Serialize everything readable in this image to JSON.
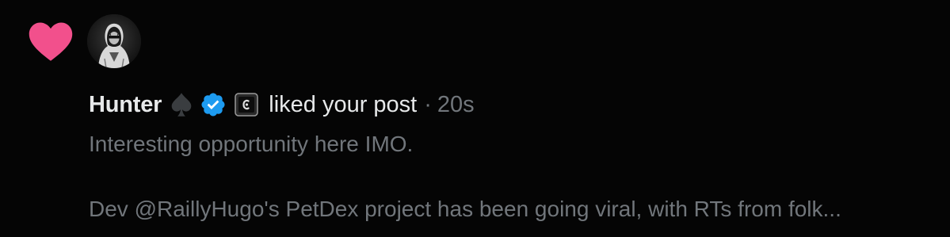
{
  "notification": {
    "type_icon": "heart-icon",
    "avatar_icon": "hooded-figure-avatar",
    "user_name": "Hunter",
    "badges": [
      "spade-icon",
      "verified-badge-icon",
      "affiliate-badge-icon"
    ],
    "action_text": "liked your post",
    "separator": "·",
    "timestamp": "20s",
    "post_preview": {
      "line1": "Interesting opportunity here IMO.",
      "line2": "Dev @RaillyHugo's PetDex project has been going viral, with RTs from folk..."
    }
  },
  "colors": {
    "heart": "#f2508c",
    "verified": "#1d9bf0",
    "primary_text": "#e7e9ea",
    "secondary_text": "#71767b",
    "background": "#050505"
  }
}
